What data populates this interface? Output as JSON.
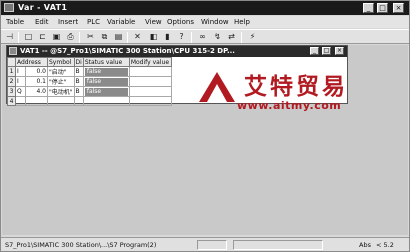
{
  "app": {
    "title": "Var - VAT1",
    "min_glyph": "_",
    "max_glyph": "□",
    "close_glyph": "×"
  },
  "menu": [
    "Table",
    "Edit",
    "Insert",
    "PLC",
    "Variable",
    "View",
    "Options",
    "Window",
    "Help"
  ],
  "toolbar": {
    "buttons": [
      {
        "icon": "pin-icon",
        "glyph": "⊣"
      },
      {
        "icon": "new-icon",
        "glyph": "□"
      },
      {
        "icon": "open-icon",
        "glyph": "⊏"
      },
      {
        "icon": "save-icon",
        "glyph": "▣"
      },
      {
        "icon": "print-icon",
        "glyph": "⎙"
      },
      {
        "icon": "cut-icon",
        "glyph": "✂"
      },
      {
        "icon": "copy-icon",
        "glyph": "⧉"
      },
      {
        "icon": "paste-icon",
        "glyph": "▤"
      },
      {
        "icon": "delete-icon",
        "glyph": "✕"
      },
      {
        "icon": "online-icon",
        "glyph": "◧"
      },
      {
        "icon": "monitor-icon",
        "glyph": "▮"
      },
      {
        "icon": "help-icon",
        "glyph": "?"
      },
      {
        "icon": "glasses-icon",
        "glyph": "∞"
      },
      {
        "icon": "modify-icon",
        "glyph": "↯"
      },
      {
        "icon": "trigger-icon",
        "glyph": "⇄"
      },
      {
        "icon": "force-icon",
        "glyph": "⚡"
      }
    ]
  },
  "inner": {
    "title": "VAT1  --  @S7_Pro1\\SIMATIC 300 Station\\CPU 315-2 DP..."
  },
  "table": {
    "headers": [
      "",
      "Address",
      "Symbol",
      "Di",
      "Status value",
      "Modify value"
    ],
    "rows": [
      {
        "n": "1",
        "area": "I",
        "addr": "0.0",
        "symbol": "\"启动\"",
        "di": "B",
        "status": "false",
        "modify": ""
      },
      {
        "n": "2",
        "area": "I",
        "addr": "0.1",
        "symbol": "\"停止\"",
        "di": "B",
        "status": "false",
        "modify": ""
      },
      {
        "n": "3",
        "area": "Q",
        "addr": "4.0",
        "symbol": "\"电动机\"",
        "di": "B",
        "status": "false",
        "modify": ""
      },
      {
        "n": "4",
        "area": "",
        "addr": "",
        "symbol": "",
        "di": "",
        "status": "",
        "modify": ""
      }
    ]
  },
  "watermark": {
    "cn": "艾特贸易",
    "url": "www.aitmy.com"
  },
  "status": {
    "path": "S7_Pro1\\SIMATIC 300 Station\\...\\S7 Program(2)",
    "mode": "Abs",
    "value": "< 5.2"
  }
}
